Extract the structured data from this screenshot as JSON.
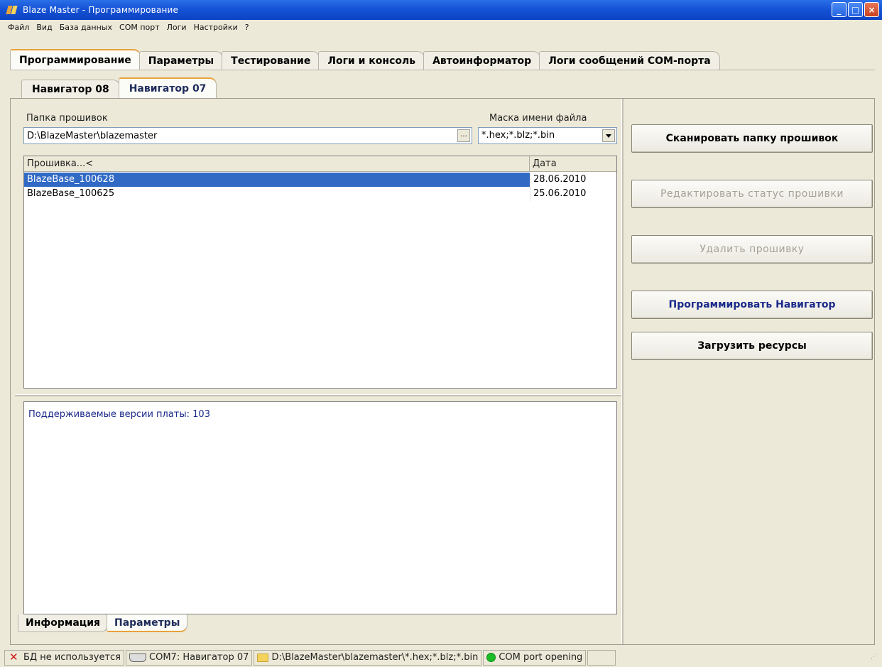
{
  "window": {
    "title": "Blaze Master - Программирование",
    "controls": {
      "minimize": "_",
      "maximize": "□",
      "close": "×"
    }
  },
  "menu": [
    "Файл",
    "Вид",
    "База данных",
    "COM порт",
    "Логи",
    "Настройки",
    "?"
  ],
  "main_tabs": [
    "Программирование",
    "Параметры",
    "Тестирование",
    "Логи и консоль",
    "Автоинформатор",
    "Логи сообщений COM-порта"
  ],
  "sub_tabs": [
    "Навигатор 08",
    "Навигатор 07"
  ],
  "firmware": {
    "folder_label": "Папка прошивок",
    "folder_value": "D:\\BlazeMaster\\blazemaster",
    "browse_label": "...",
    "mask_label": "Маска имени файла",
    "mask_value": "*.hex;*.blz;*.bin",
    "columns": [
      "Прошивка...<",
      "Дата"
    ],
    "rows": [
      {
        "name": "BlazeBase_100628",
        "date": "28.06.2010"
      },
      {
        "name": "BlazeBase_100625",
        "date": "25.06.2010"
      }
    ]
  },
  "info": {
    "text": "Поддерживаемые версии платы: 103"
  },
  "bottom_tabs": [
    "Информация",
    "Параметры"
  ],
  "actions": {
    "scan": "Сканировать папку прошивок",
    "edit_status": "Редактировать статус прошивки",
    "delete": "Удалить прошивку",
    "program": "Программировать Навигатор",
    "load_resources": "Загрузить ресурсы"
  },
  "status": {
    "db": "БД не используется",
    "port": "COM7: Навигатор 07",
    "path": "D:\\BlazeMaster\\blazemaster\\*.hex;*.blz;*.bin",
    "state": "COM port opening"
  },
  "colors": {
    "selection": "#316ac5",
    "accent_tab": "#e8a23a",
    "status_ok": "#1bbd27",
    "info_text": "#1b2a8a"
  }
}
